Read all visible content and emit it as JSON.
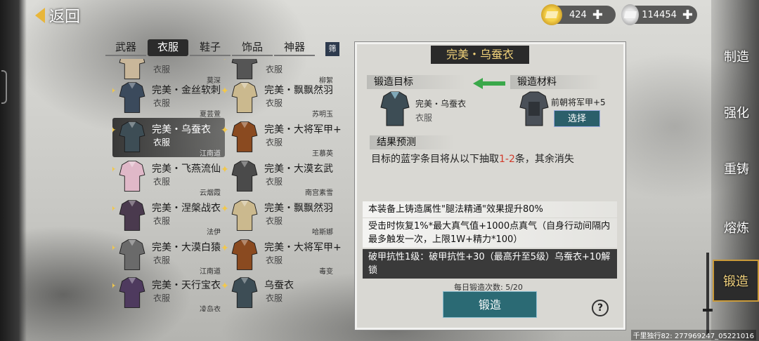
{
  "top": {
    "back_label": "返回",
    "gold": "424",
    "silver": "114454"
  },
  "tabs": [
    {
      "label": "武器"
    },
    {
      "label": "衣服"
    },
    {
      "label": "鞋子"
    },
    {
      "label": "饰品"
    },
    {
      "label": "神器"
    }
  ],
  "filter_label": "筛",
  "items": [
    {
      "name": "",
      "type": "衣服",
      "owner": "莫深",
      "color": "#c9b79a"
    },
    {
      "name": "",
      "type": "衣服",
      "owner": "柳絮",
      "color": "#555"
    },
    {
      "name": "完美・金丝软刺",
      "type": "衣服",
      "owner": "夏芸萱",
      "color": "#3b4a5c"
    },
    {
      "name": "完美・飘飘然羽",
      "type": "衣服",
      "owner": "苏明玉",
      "color": "#cbb98e"
    },
    {
      "name": "完美・乌蚕衣",
      "type": "衣服",
      "owner": "江南道",
      "color": "#3d4d55"
    },
    {
      "name": "完美・大将军甲+",
      "type": "衣服",
      "owner": "王慕英",
      "color": "#8a4a20"
    },
    {
      "name": "完美・飞燕流仙",
      "type": "衣服",
      "owner": "云烟霞",
      "color": "#e0b8c8"
    },
    {
      "name": "完美・大漠玄武",
      "type": "衣服",
      "owner": "南宫素雪",
      "color": "#4a4a4a"
    },
    {
      "name": "完美・涅槃战衣",
      "type": "衣服",
      "owner": "法伊",
      "color": "#4a3a4e"
    },
    {
      "name": "完美・飘飘然羽",
      "type": "衣服",
      "owner": "哈斯娜",
      "color": "#cbb98e"
    },
    {
      "name": "完美・大漠白猿",
      "type": "衣服",
      "owner": "江南道",
      "color": "#6a6a6a"
    },
    {
      "name": "完美・大将军甲+",
      "type": "衣服",
      "owner": "毒变",
      "color": "#8a4a20"
    },
    {
      "name": "完美・天行宝衣",
      "type": "衣服",
      "owner": "凌岛衣",
      "color": "#4e3a5e"
    },
    {
      "name": "乌蚕衣",
      "type": "衣服",
      "owner": "",
      "color": "#3d4d55"
    }
  ],
  "panel": {
    "title": "完美・乌蚕衣",
    "target_label": "锻造目标",
    "material_label": "锻造材料",
    "target_name": "完美・乌蚕衣",
    "target_type": "衣服",
    "material_name": "前朝将军甲+5",
    "select_label": "选择",
    "result_label": "结果预测",
    "result_pre": "目标的蓝字条目将从以下抽取",
    "result_range": "1-2",
    "result_post": "条，其余消失",
    "attr1": "本装备上铸造属性\"腿法精通\"效果提升80%",
    "attr2": "受击时恢复1%*最大真气值+1000点真气（自身行动间隔内最多触发一次，上限1W+精力*100）",
    "attr3": "破甲抗性1级：破甲抗性+30（最高升至5级）乌蚕衣+10解锁",
    "daily": "每日锻造次数: 5/20",
    "forge_label": "锻造",
    "help": "?"
  },
  "side_menu": [
    {
      "label": "制造"
    },
    {
      "label": "强化"
    },
    {
      "label": "重铸"
    },
    {
      "label": "熔炼"
    },
    {
      "label": "锻造"
    }
  ],
  "footer": "千里独行82: 277969247_05221016"
}
